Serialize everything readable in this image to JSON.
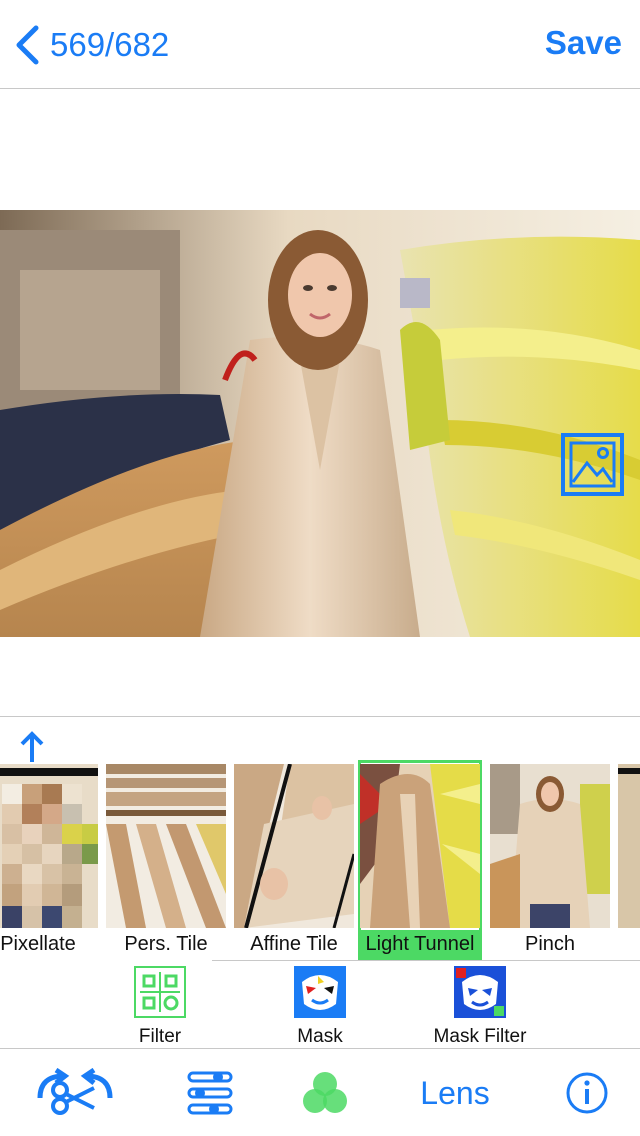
{
  "nav": {
    "counter": "569/682",
    "save_label": "Save"
  },
  "filters": [
    {
      "label": "Pixellate",
      "selected": false
    },
    {
      "label": "Pers. Tile",
      "selected": false
    },
    {
      "label": "Affine Tile",
      "selected": false
    },
    {
      "label": "Light Tunnel",
      "selected": true
    },
    {
      "label": "Pinch",
      "selected": false
    }
  ],
  "modes": {
    "filter": "Filter",
    "mask": "Mask",
    "mask_filter": "Mask Filter"
  },
  "tabbar": {
    "lens": "Lens"
  },
  "colors": {
    "accent": "#1a7cf5",
    "selected": "#4cd964"
  },
  "icons": [
    "back-chevron-icon",
    "gallery-icon",
    "up-arrow-icon",
    "filter-icon",
    "mask-icon",
    "mask-filter-icon",
    "crop-rotate-icon",
    "sliders-icon",
    "color-circles-icon",
    "info-icon"
  ]
}
